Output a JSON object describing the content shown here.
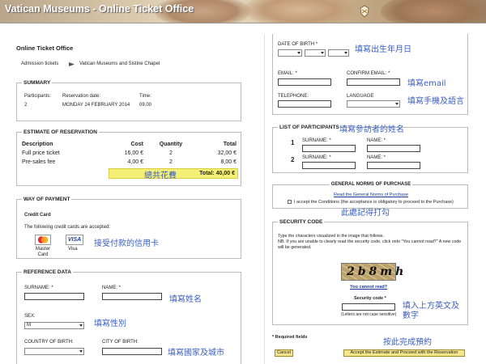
{
  "header": {
    "title": "Vatican Museums - Online Ticket Office"
  },
  "left": {
    "office_title": "Online Ticket Office",
    "breadcrumb": [
      "Admission tickets",
      "Vatican Museums and Sistine Chapel"
    ],
    "summary": {
      "title": "SUMMARY",
      "labels": {
        "participants": "Participants:",
        "date": "Reservation date:",
        "time": "Time:"
      },
      "values": {
        "participants": "2",
        "date": "MONDAY 24 FEBRUARY 2014",
        "time": "09.00"
      }
    },
    "estimate": {
      "title": "ESTIMATE OF RESERVATION",
      "headers": [
        "Description",
        "Cost",
        "Quantity",
        "Total"
      ],
      "rows": [
        {
          "desc": "Full price ticket",
          "cost": "16,00 €",
          "qty": "2",
          "total": "32,00 €"
        },
        {
          "desc": "Pre-sales fee",
          "cost": "4,00 €",
          "qty": "2",
          "total": "8,00 €"
        }
      ],
      "total": "Total: 40,00 €",
      "annotation": "總共花費"
    },
    "payment": {
      "title": "WAY OF PAYMENT",
      "subtitle": "Credit Card",
      "text": "The following credit cards are accepted:",
      "cards": [
        {
          "label": "Master Card",
          "logo": "MasterCard"
        },
        {
          "label": "Visa",
          "logo": "VISA"
        }
      ],
      "annotation": "接受付款的信用卡"
    },
    "reference": {
      "title": "REFERENCE DATA",
      "surname_label": "SURNAME: *",
      "name_label": "NAME: *",
      "sex_label": "SEX:",
      "sex_value": "M",
      "country_label": "COUNTRY OF BIRTH:",
      "city_label": "CITY OF BIRTH:",
      "annotation_name": "填寫姓名",
      "annotation_sex": "填寫性別",
      "annotation_country": "填寫國家及城市"
    }
  },
  "right": {
    "dob": {
      "label": "DATE OF BIRTH *",
      "annotation": "填寫出生年月日"
    },
    "contact": {
      "email_label": "EMAIL: *",
      "confirm_label": "CONFIRM EMAIL: *",
      "phone_label": "TELEPHONE:",
      "lang_label": "LANGUAGE",
      "annotation_email": "填寫email",
      "annotation_phone": "填寫手機及語言"
    },
    "participants": {
      "title": "LIST OF PARTICIPANTS",
      "annotation": "填寫參訪者的姓名",
      "surname_label": "SURNAME: *",
      "name_label": "NAME: *",
      "rows": [
        "1",
        "2"
      ]
    },
    "norms": {
      "title": "GENERAL NORMS OF PURCHASE",
      "link": "Read the General Norms of Purchase",
      "accept": "I accept the Conditions (the acceptance is obligatory to proceed to the Purchase)",
      "annotation": "此處記得打勾"
    },
    "security": {
      "title": "SECURITY CODE",
      "line1": "Type the characters visualized in the image that follows.",
      "line2": "NB. If you are unable to clearly read the security code, click onto \"You cannot read?\" A new code will be generated.",
      "captcha": "2b8mh",
      "cannot_read": "You cannot read?",
      "code_label": "Security code *",
      "case_note": "(Letters are not case sensitive)",
      "annotation": "填入上方英文及數字"
    },
    "required": "* Required fields",
    "submit_annotation": "按此完成預約",
    "cancel": "Cancel",
    "accept_btn": "Accept the Estimate and Proceed with the Reservation"
  }
}
